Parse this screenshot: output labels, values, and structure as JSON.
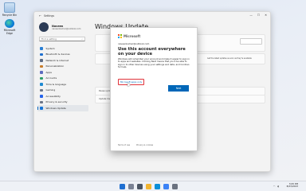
{
  "desktop": {
    "icons": [
      {
        "label": "Recycle Bin",
        "icon": "recycle-bin-icon"
      },
      {
        "label": "Microsoft Edge",
        "icon": "edge-icon"
      }
    ]
  },
  "settings": {
    "title": "Settings",
    "page_title": "Windows Update",
    "profile": {
      "name": "Naveen",
      "email": "naveenkumar@outlook.com"
    },
    "search_placeholder": "Find a setting",
    "nav": [
      {
        "label": "System",
        "icon": "system-icon",
        "color": "#2a7fd4"
      },
      {
        "label": "Bluetooth & devices",
        "icon": "bluetooth-icon",
        "color": "#1e6fcf"
      },
      {
        "label": "Network & internet",
        "icon": "wifi-icon",
        "color": "#5c6b84"
      },
      {
        "label": "Personalization",
        "icon": "brush-icon",
        "color": "#c77b2a"
      },
      {
        "label": "Apps",
        "icon": "apps-icon",
        "color": "#5c6bc0"
      },
      {
        "label": "Accounts",
        "icon": "person-icon",
        "color": "#2e9e6b"
      },
      {
        "label": "Time & language",
        "icon": "globe-clock-icon",
        "color": "#1f8ad2"
      },
      {
        "label": "Gaming",
        "icon": "controller-icon",
        "color": "#6b7486"
      },
      {
        "label": "Accessibility",
        "icon": "accessibility-icon",
        "color": "#2563eb"
      },
      {
        "label": "Privacy & security",
        "icon": "shield-icon",
        "color": "#6b7486"
      },
      {
        "label": "Windows Update",
        "icon": "update-icon",
        "color": "#1573d6"
      }
    ],
    "active_nav": 10,
    "background_text": {
      "get_latest": "Get the latest updates as soon as they're available",
      "pause_updates": "Pause updates",
      "update_history": "Update history",
      "check_button": "Check for updates"
    }
  },
  "dialog": {
    "brand": "Microsoft",
    "email": "naveenkumar@outlook.com",
    "heading": "Use this account everywhere on your device",
    "body": "Windows will remember your account and make it easier to sign in to apps and websites. Clicking Next means that you'll be able to sign in to other devices using your settings and data, and Contoso for help.",
    "link": "Microsoft apps only",
    "next_button": "Next",
    "footer": [
      "Terms of use",
      "Privacy & cookies"
    ]
  },
  "taskbar": {
    "time": "3:05 PM",
    "date": "8/23/2023",
    "apps": [
      {
        "icon": "start-icon",
        "color": "#1f6fd1"
      },
      {
        "icon": "search-icon",
        "color": "#7a8294"
      },
      {
        "icon": "task-view-icon",
        "color": "#4b5563"
      },
      {
        "icon": "explorer-icon",
        "color": "#f2b531"
      },
      {
        "icon": "edge-icon",
        "color": "#0a8fd8"
      },
      {
        "icon": "store-icon",
        "color": "#3b82f6"
      },
      {
        "icon": "settings-icon",
        "color": "#6b7280"
      }
    ]
  }
}
